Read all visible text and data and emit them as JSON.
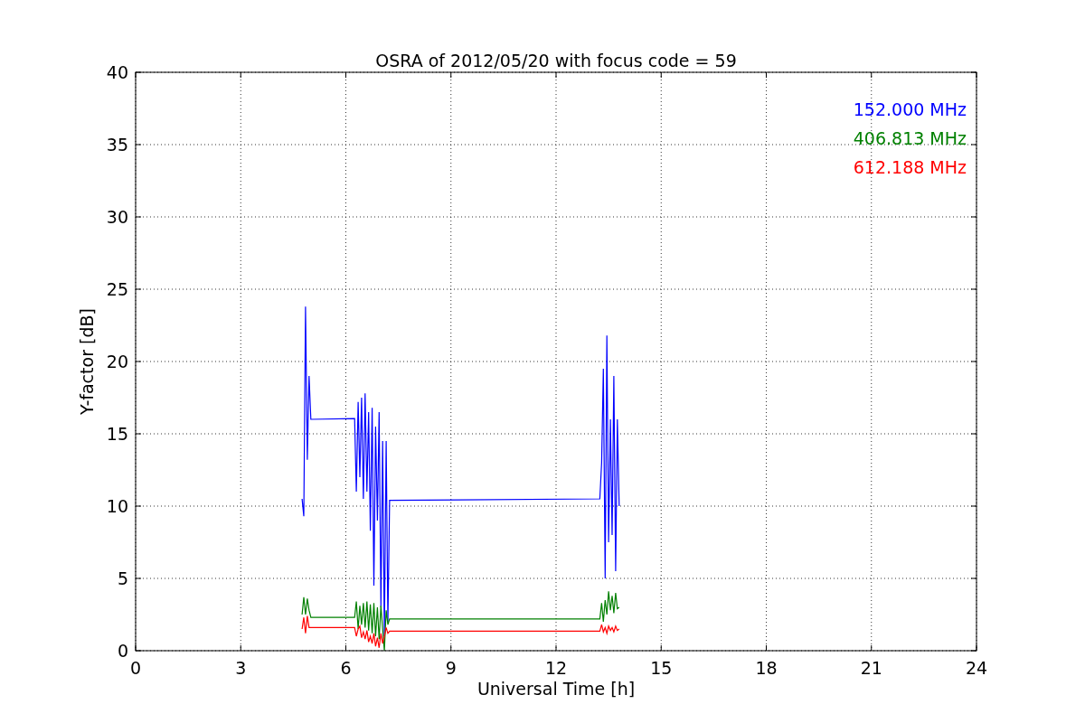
{
  "chart_data": {
    "type": "line",
    "title": "OSRA of 2012/05/20 with focus code = 59",
    "xlabel": "Universal Time [h]",
    "ylabel": "Y-factor [dB]",
    "xlim": [
      0,
      24
    ],
    "ylim": [
      0,
      40
    ],
    "grid": true,
    "xticks": [
      0,
      3,
      6,
      9,
      12,
      15,
      18,
      21,
      24
    ],
    "yticks": [
      0,
      5,
      10,
      15,
      20,
      25,
      30,
      35,
      40
    ],
    "x": [
      4.75,
      4.8,
      4.85,
      4.9,
      4.95,
      5.0,
      6.25,
      6.3,
      6.35,
      6.4,
      6.45,
      6.5,
      6.55,
      6.6,
      6.65,
      6.7,
      6.75,
      6.8,
      6.85,
      6.9,
      6.95,
      7.0,
      7.05,
      7.1,
      7.15,
      7.2,
      7.25,
      13.25,
      13.3,
      13.35,
      13.4,
      13.45,
      13.5,
      13.55,
      13.6,
      13.65,
      13.7,
      13.75,
      13.8
    ],
    "series": [
      {
        "name": "152.000 MHz",
        "color": "#0000ff",
        "values": [
          10.5,
          9.3,
          23.8,
          13.2,
          19,
          16,
          16.05,
          11,
          17.2,
          12,
          17.5,
          10.5,
          17.8,
          11,
          16.5,
          8.3,
          16.8,
          4.5,
          15.5,
          9,
          16.5,
          3,
          14.5,
          1,
          14.5,
          2,
          10.4,
          10.5,
          13,
          19.5,
          5,
          21.8,
          7.5,
          16,
          8,
          19,
          5.5,
          16,
          10
        ]
      },
      {
        "name": "406.813 MHz",
        "color": "#008000",
        "values": [
          2.5,
          3.7,
          2.5,
          3.6,
          2.8,
          2.3,
          2.3,
          3.4,
          1.5,
          3.1,
          1.8,
          3.3,
          1.6,
          3.4,
          1.4,
          3.2,
          1.2,
          3.3,
          1.0,
          3.0,
          0.8,
          3.1,
          1.5,
          0,
          2.8,
          1.8,
          2.2,
          2.2,
          3.3,
          2.0,
          3.5,
          2.5,
          4.1,
          2.8,
          3.8,
          2.6,
          4.0,
          2.9,
          3.0
        ]
      },
      {
        "name": "612.188 MHz",
        "color": "#ff0000",
        "values": [
          1.5,
          2.3,
          1.2,
          2.4,
          1.6,
          1.6,
          1.6,
          1.0,
          1.5,
          1.7,
          0.9,
          1.3,
          0.8,
          1.4,
          0.6,
          1.0,
          0.5,
          1.2,
          0.3,
          0.9,
          0.2,
          1.2,
          0.5,
          1.0,
          1.6,
          1.2,
          1.35,
          1.35,
          1.8,
          1.3,
          1.6,
          1.2,
          1.7,
          1.4,
          1.6,
          1.3,
          1.7,
          1.4,
          1.5
        ]
      }
    ]
  }
}
